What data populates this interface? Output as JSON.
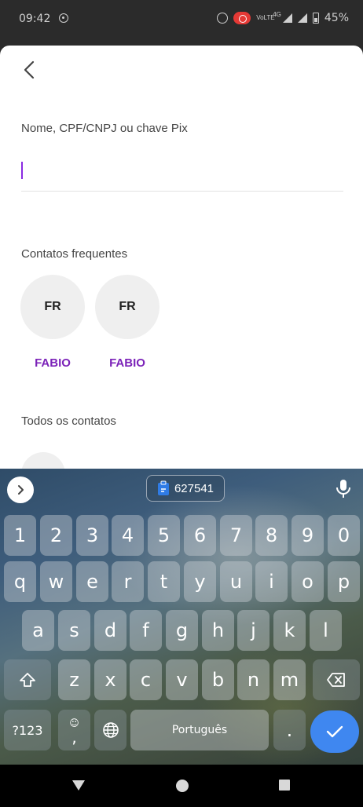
{
  "status_bar": {
    "time": "09:42",
    "network": "4G",
    "battery": "45%",
    "icons": [
      "whatsapp-icon",
      "alarm-icon",
      "screen-record-icon",
      "volte-icon",
      "signal-icon",
      "battery-icon"
    ]
  },
  "header": {
    "back_icon": "chevron-left-icon"
  },
  "search": {
    "label": "Nome, CPF/CNPJ ou chave Pix",
    "value": ""
  },
  "frequent": {
    "title": "Contatos frequentes",
    "contacts": [
      {
        "initials": "FR",
        "name": "FABIO"
      },
      {
        "initials": "FR",
        "name": "FABIO"
      }
    ]
  },
  "all_contacts": {
    "title": "Todos os contatos"
  },
  "keyboard": {
    "clipboard_text": "627541",
    "row_numbers": [
      "1",
      "2",
      "3",
      "4",
      "5",
      "6",
      "7",
      "8",
      "9",
      "0"
    ],
    "row1": [
      "q",
      "w",
      "e",
      "r",
      "t",
      "y",
      "u",
      "i",
      "o",
      "p"
    ],
    "row2": [
      "a",
      "s",
      "d",
      "f",
      "g",
      "h",
      "j",
      "k",
      "l"
    ],
    "row3": [
      "z",
      "x",
      "c",
      "v",
      "b",
      "n",
      "m"
    ],
    "symbols_label": "?123",
    "emoji_comma": ",",
    "space_label": "Português",
    "period": "."
  },
  "colors": {
    "accent": "#7b22b8",
    "caret": "#8a2be2",
    "enter": "#3f87f0"
  }
}
